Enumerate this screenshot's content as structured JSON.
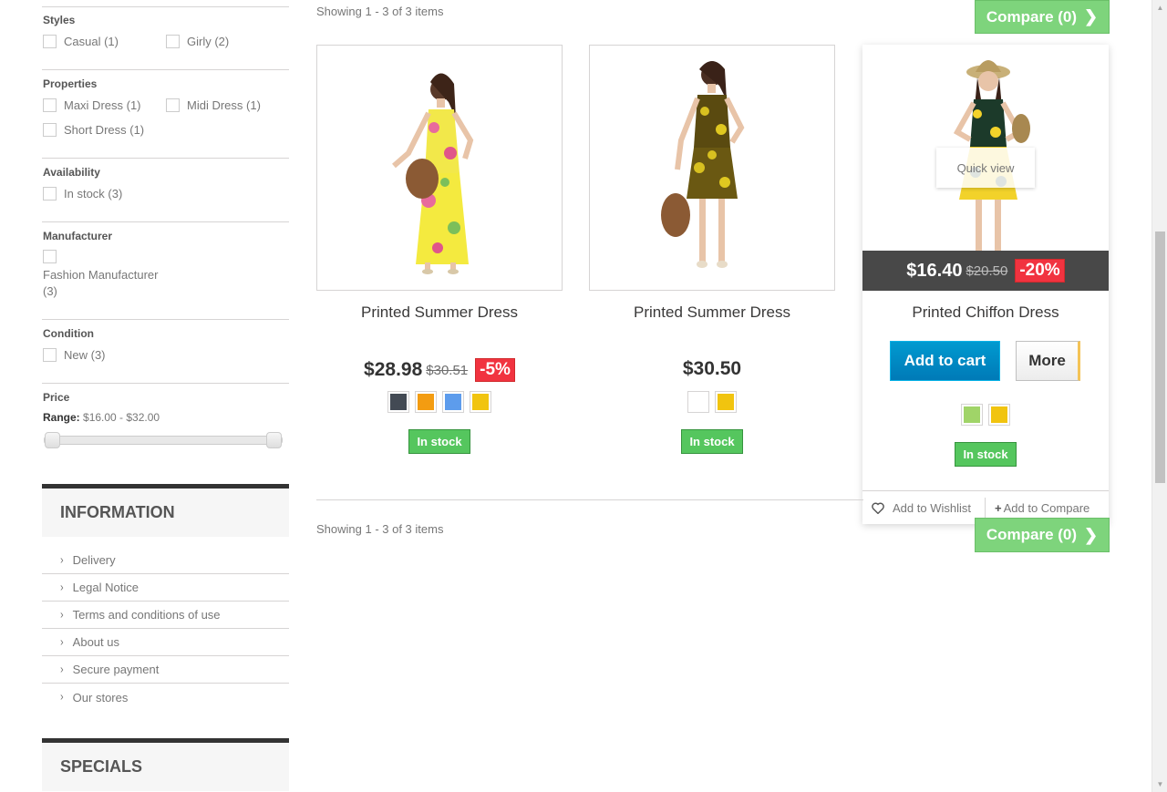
{
  "filters": {
    "styles": {
      "title": "Styles",
      "options": [
        {
          "label": "Casual (1)"
        },
        {
          "label": "Girly (2)"
        }
      ]
    },
    "properties": {
      "title": "Properties",
      "options": [
        {
          "label": "Maxi Dress (1)"
        },
        {
          "label": "Midi Dress (1)"
        },
        {
          "label": "Short Dress (1)"
        }
      ]
    },
    "availability": {
      "title": "Availability",
      "options": [
        {
          "label": "In stock (3)"
        }
      ]
    },
    "manufacturer": {
      "title": "Manufacturer",
      "options": [
        {
          "label": "Fashion Manufacturer (3)"
        }
      ]
    },
    "condition": {
      "title": "Condition",
      "options": [
        {
          "label": "New (3)"
        }
      ]
    },
    "price": {
      "title": "Price",
      "range_label": "Range:",
      "range_value": "$16.00 - $32.00",
      "min": 16.0,
      "max": 32.0
    }
  },
  "information": {
    "title": "INFORMATION",
    "items": [
      "Delivery",
      "Legal Notice",
      "Terms and conditions of use",
      "About us",
      "Secure payment",
      "Our stores"
    ]
  },
  "specials": {
    "title": "SPECIALS"
  },
  "listing": {
    "showing_top": "Showing 1 - 3 of 3 items",
    "showing_bottom": "Showing 1 - 3 of 3 items",
    "compare_label": "Compare (0)",
    "compare_icon": "chevron-right-icon"
  },
  "products": [
    {
      "name": "Printed Summer Dress",
      "price": "$28.98",
      "old_price": "$30.51",
      "reduction": "-5%",
      "colors": [
        "#434a54",
        "#f39c11",
        "#5d9cec",
        "#f1c40f"
      ],
      "availability": "In stock"
    },
    {
      "name": "Printed Summer Dress",
      "price": "$30.50",
      "colors": [
        "#ffffff",
        "#f1c40f"
      ],
      "availability": "In stock"
    },
    {
      "name": "Printed Chiffon Dress",
      "price": "$16.40",
      "old_price": "$20.50",
      "reduction": "-20%",
      "colors": [
        "#a0d468",
        "#f1c40f"
      ],
      "availability": "In stock",
      "quick_view": "Quick view",
      "add_to_cart": "Add to cart",
      "more": "More",
      "wishlist": "Add to Wishlist",
      "compare": "Add to Compare"
    }
  ]
}
